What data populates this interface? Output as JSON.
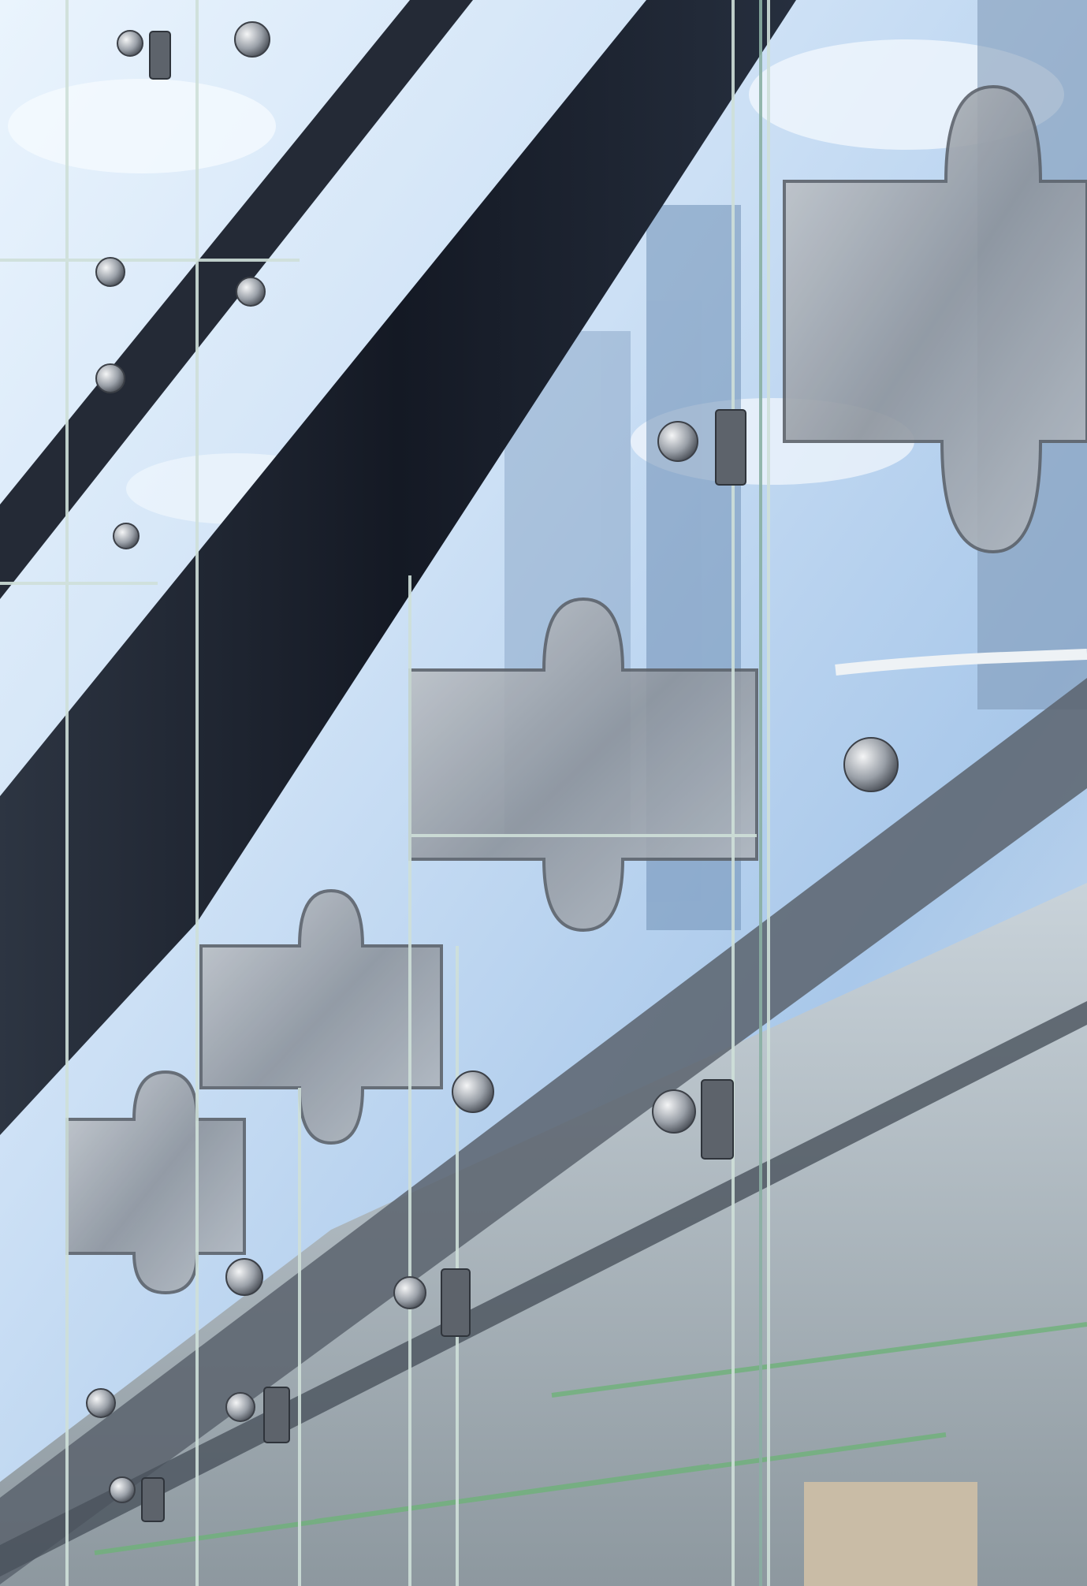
{
  "photo": {
    "subject": "",
    "colors": {
      "sky_light": "#eaf4fd",
      "sky_mid": "#b9d4ef",
      "sky_deep": "#7fa8d6",
      "beam_dark": "#1a1f2b",
      "beam_edge": "#3b4657",
      "steel": "#9aa0a8",
      "steel_dark": "#5d636b",
      "glass_edge": "#cfe0d9",
      "street_green": "#5fa36c"
    }
  }
}
